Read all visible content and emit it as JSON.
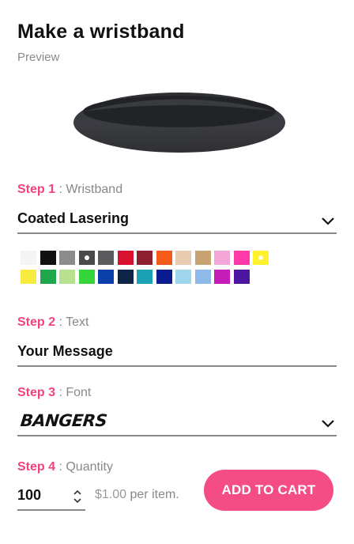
{
  "header": {
    "title": "Make a wristband",
    "preview_label": "Preview"
  },
  "step1": {
    "step": "Step 1",
    "label": ": Wristband",
    "selected": "Coated Lasering",
    "icon": "chevron-down-icon"
  },
  "swatches": {
    "row1": [
      "#f4f4f4",
      "#111111",
      "#8c8c8c",
      "#4a4a4a",
      "#5b5b5d",
      "#d8112e",
      "#8e1f2f",
      "#f55a1b",
      "#e8cbb0",
      "#c9a273",
      "#f4a6d8",
      "#ff3aa8",
      "#fff12b"
    ],
    "row2": [
      "#f7ea41",
      "#1ea84b",
      "#b7e08f",
      "#36d63a",
      "#0b3fa9",
      "#0e2447",
      "#1aa1b3",
      "#0a1c8f",
      "#9fd6ee",
      "#8fb9e8",
      "#c61cb7",
      "#4b15a0"
    ],
    "selected": "#4a4a4a"
  },
  "step2": {
    "step": "Step 2",
    "label": ": Text",
    "value": "Your Message"
  },
  "step3": {
    "step": "Step 3",
    "label": ": Font",
    "selected": "BANGERS",
    "icon": "chevron-down-icon"
  },
  "step4": {
    "step": "Step 4",
    "label": ": Quantity",
    "quantity": "100",
    "icon": "stepper-icon",
    "price": "$1.00",
    "price_suffix": " per item."
  },
  "cart": {
    "label": "ADD TO CART"
  },
  "colors": {
    "accent": "#f0437e",
    "button": "#f44d85",
    "band": "#3b3c40"
  }
}
